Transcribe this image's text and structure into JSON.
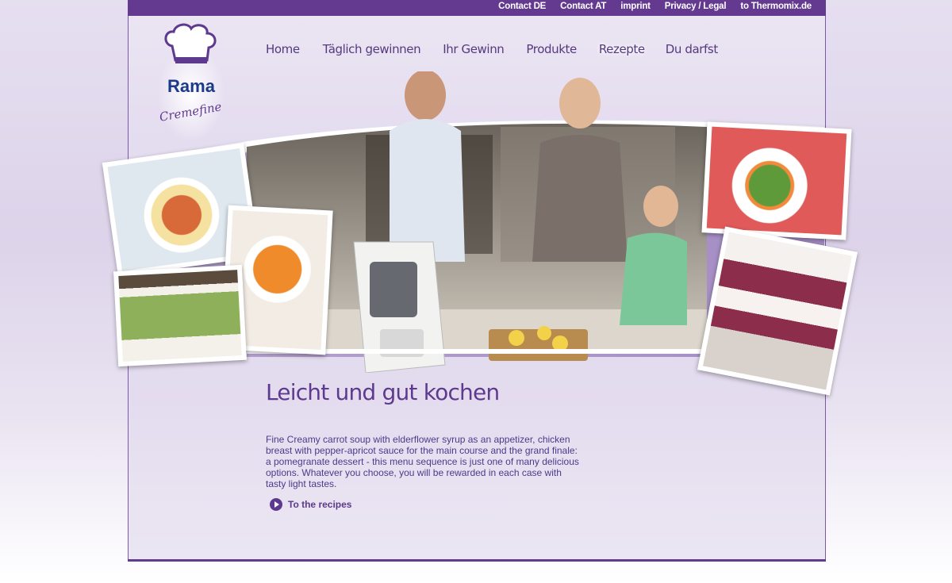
{
  "top_links": [
    "Contact DE",
    "Contact AT",
    "imprint",
    "Privacy / Legal",
    "to Thermomix.de"
  ],
  "logo": {
    "brand": "Rama",
    "product": "Cremefine",
    "icon": "chef-hat-icon"
  },
  "nav": {
    "items": [
      "Home",
      "Täglich gewinnen",
      "Ihr Gewinn",
      "Produkte",
      "Rezepte",
      "Du darfst"
    ],
    "active": "Rezepte"
  },
  "content": {
    "heading": "Leicht und gut kochen",
    "description": "Fine Creamy carrot soup with elderflower syrup as an appetizer, chicken breast with pepper-apricot sauce for the main course and the grand finale: a pomegranate dessert - this menu sequence is just one of many delicious options. Whatever you choose, you will be rewarded in each case with tasty light tastes.",
    "cta": "To the recipes"
  },
  "colors": {
    "primary": "#643a91",
    "text": "#4b3a8a",
    "background": "#e4dcef"
  }
}
